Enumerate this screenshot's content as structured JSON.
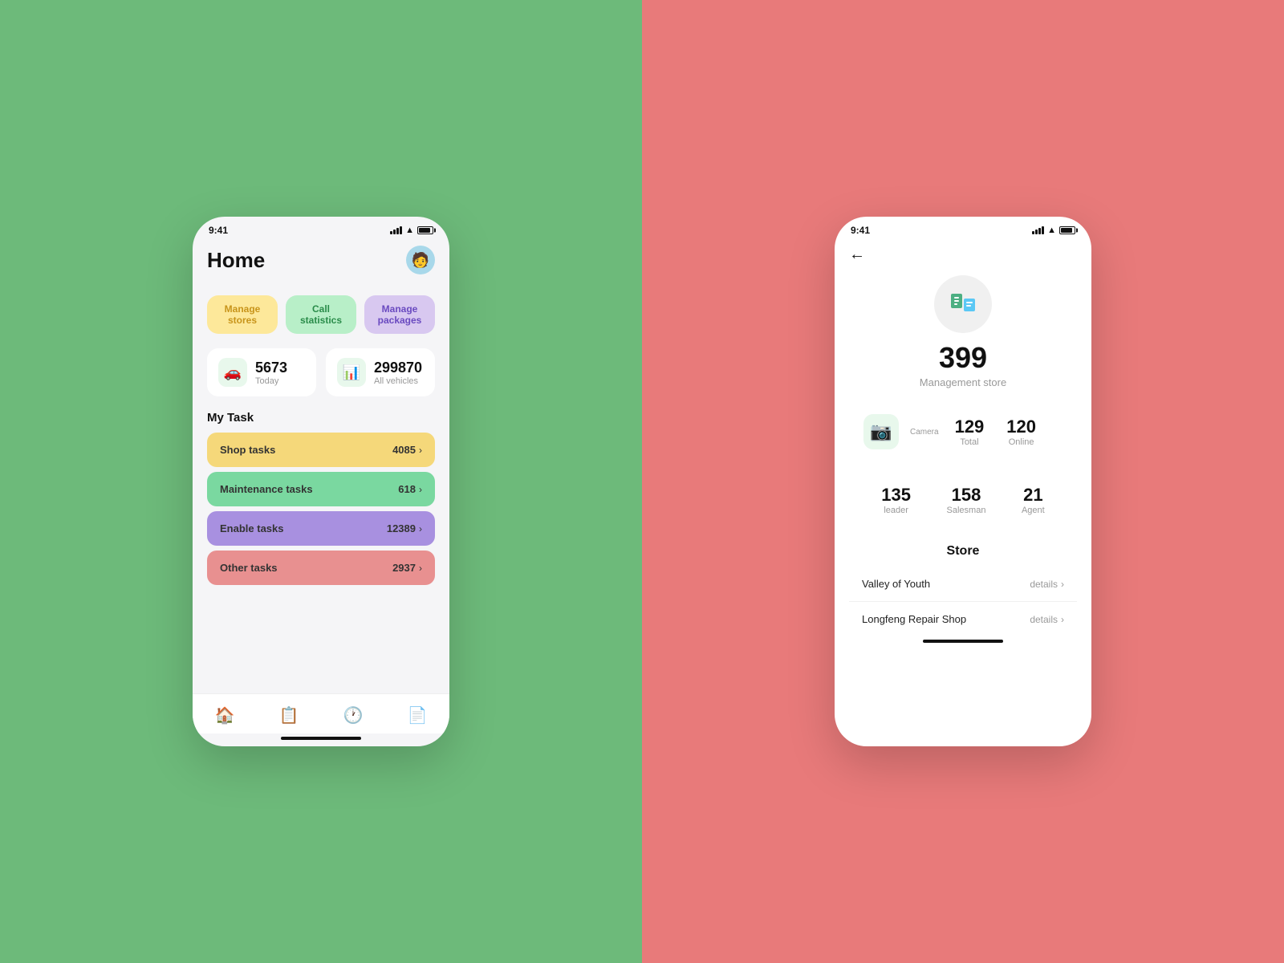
{
  "left": {
    "background": "#6dba7a",
    "phone": {
      "status_bar": {
        "time": "9:41"
      },
      "header": {
        "title": "Home",
        "avatar_emoji": "🧑"
      },
      "quick_actions": [
        {
          "id": "manage-stores",
          "label": "Manage\nstores",
          "style": "yellow"
        },
        {
          "id": "call-statistics",
          "label": "Call\nstatistics",
          "style": "green"
        },
        {
          "id": "manage-packages",
          "label": "Manage\npackages",
          "style": "purple"
        }
      ],
      "stats": [
        {
          "id": "today",
          "icon": "🚗",
          "value": "5673",
          "label": "Today"
        },
        {
          "id": "all-vehicles",
          "icon": "📊",
          "value": "299870",
          "label": "All vehicles"
        }
      ],
      "my_task": {
        "title": "My Task",
        "tasks": [
          {
            "id": "shop-tasks",
            "name": "Shop tasks",
            "count": "4085",
            "style": "yellow"
          },
          {
            "id": "maintenance-tasks",
            "name": "Maintenance tasks",
            "count": "618",
            "style": "green"
          },
          {
            "id": "enable-tasks",
            "name": "Enable tasks",
            "count": "12389",
            "style": "purple"
          },
          {
            "id": "other-tasks",
            "name": "Other tasks",
            "count": "2937",
            "style": "red"
          }
        ]
      },
      "bottom_nav": [
        {
          "id": "home",
          "icon": "🏠",
          "active": true
        },
        {
          "id": "tasks",
          "icon": "📋",
          "active": false
        },
        {
          "id": "clock",
          "icon": "🕐",
          "active": false
        },
        {
          "id": "docs",
          "icon": "📄",
          "active": false
        }
      ]
    }
  },
  "right": {
    "background": "#e87a7a",
    "phone": {
      "status_bar": {
        "time": "9:41"
      },
      "store_detail": {
        "count": "399",
        "label": "Management store",
        "icon": "📋",
        "camera_section": {
          "camera_label": "Camera",
          "total_value": "129",
          "total_label": "Total",
          "online_value": "120",
          "online_label": "Online"
        },
        "people_section": {
          "leader_value": "135",
          "leader_label": "leader",
          "salesman_value": "158",
          "salesman_label": "Salesman",
          "agent_value": "21",
          "agent_label": "Agent"
        },
        "store_section": {
          "title": "Store",
          "items": [
            {
              "name": "Valley of Youth",
              "details": "details"
            },
            {
              "name": "Longfeng Repair Shop",
              "details": "details"
            }
          ]
        }
      }
    }
  }
}
